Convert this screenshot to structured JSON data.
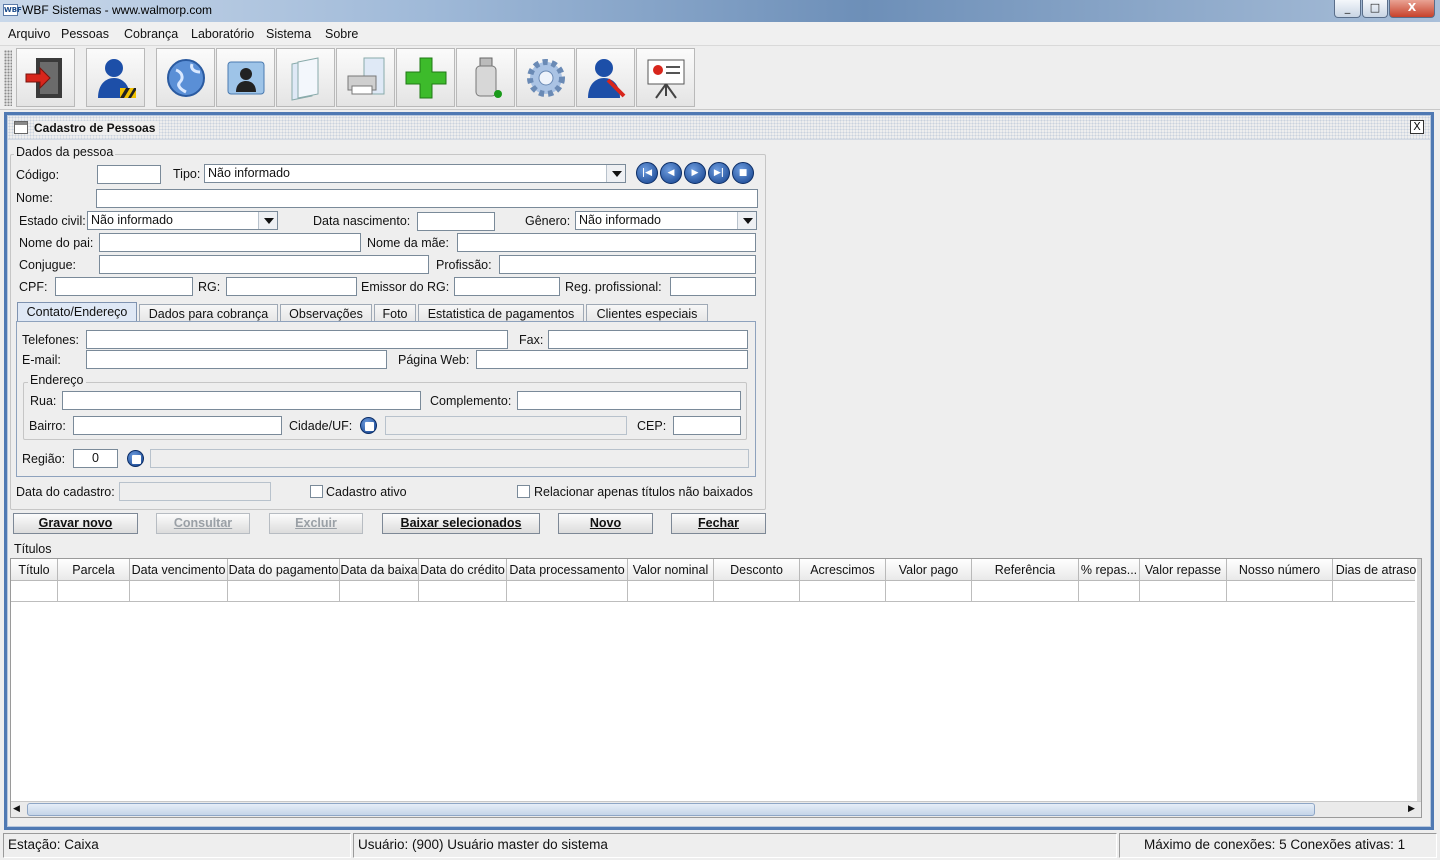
{
  "window": {
    "title": "WBF Sistemas - www.walmorp.com",
    "app_icon": "WBF",
    "minimize": "_",
    "maximize": "□",
    "close": "X"
  },
  "menu": [
    "Arquivo",
    "Pessoas",
    "Cobrança",
    "Laboratório",
    "Sistema",
    "Sobre"
  ],
  "toolbar": [
    "exit-icon",
    "person-user-icon",
    "globe-icon",
    "contact-card-icon",
    "documents-icon",
    "printer-icon",
    "plus-icon",
    "usb-drive-icon",
    "gear-icon",
    "user-tools-icon",
    "presentation-icon"
  ],
  "internal_frame": {
    "title": "Cadastro de Pessoas",
    "close": "X"
  },
  "dados": {
    "group_title": "Dados da pessoa",
    "codigo_label": "Código:",
    "codigo_value": "",
    "tipo_label": "Tipo:",
    "tipo_value": "Não informado",
    "nome_label": "Nome:",
    "estado_civil_label": "Estado civil:",
    "estado_civil_value": "Não informado",
    "data_nasc_label": "Data nascimento:",
    "genero_label": "Gênero:",
    "genero_value": "Não informado",
    "nome_pai_label": "Nome do pai:",
    "nome_mae_label": "Nome da mãe:",
    "conjugue_label": "Conjugue:",
    "profissao_label": "Profissão:",
    "cpf_label": "CPF:",
    "rg_label": "RG:",
    "emissor_label": "Emissor do RG:",
    "reg_prof_label": "Reg. profissional:"
  },
  "tabs": [
    "Contato/Endereço",
    "Dados para cobrança",
    "Observações",
    "Foto",
    "Estatistica de pagamentos",
    "Clientes especiais"
  ],
  "contato": {
    "telefones_label": "Telefones:",
    "fax_label": "Fax:",
    "email_label": "E-mail:",
    "pagina_label": "Página Web:",
    "endereco_title": "Endereço",
    "rua_label": "Rua:",
    "complemento_label": "Complemento:",
    "bairro_label": "Bairro:",
    "cidade_label": "Cidade/UF:",
    "cep_label": "CEP:",
    "regiao_label": "Região:",
    "regiao_value": "0"
  },
  "footer_fields": {
    "data_cadastro_label": "Data do cadastro:",
    "cadastro_ativo_label": "Cadastro ativo",
    "relacionar_label": "Relacionar apenas títulos não baixados"
  },
  "buttons": [
    "Gravar novo",
    "Consultar",
    "Excluir",
    "Baixar selecionados",
    "Novo",
    "Fechar"
  ],
  "titulos": {
    "title": "Títulos",
    "columns": [
      "Título",
      "Parcela",
      "Data vencimento",
      "Data do pagamento",
      "Data da baixa",
      "Data do crédito",
      "Data processamento",
      "Valor nominal",
      "Desconto",
      "Acrescimos",
      "Valor pago",
      "Referência",
      "% repas...",
      "Valor repasse",
      "Nosso número",
      "Dias de atraso"
    ]
  },
  "status": {
    "estacao": "Estação: Caixa",
    "usuario": "Usuário: (900) Usuário master do sistema",
    "conexoes": "Máximo de conexões: 5 Conexões ativas: 1"
  }
}
